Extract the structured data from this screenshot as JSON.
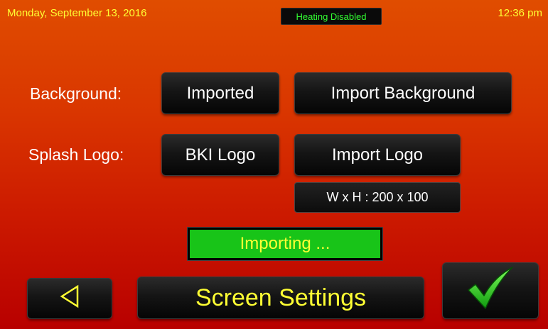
{
  "header": {
    "date": "Monday, September 13, 2016",
    "status": "Heating Disabled",
    "time": "12:36 pm"
  },
  "background": {
    "label": "Background:",
    "value_button": "Imported",
    "import_button": "Import Background"
  },
  "splash_logo": {
    "label": "Splash Logo:",
    "value_button": "BKI Logo",
    "import_button": "Import Logo",
    "dimensions": "W x H : 200 x 100"
  },
  "progress": {
    "label": "Importing ...",
    "fraction": 1.0
  },
  "footer": {
    "back_icon": "back-triangle-icon",
    "title": "Screen Settings",
    "confirm_icon": "checkmark-icon"
  },
  "colors": {
    "accent_yellow": "#ffff33",
    "status_green": "#33ff33",
    "progress_green": "#18c418",
    "checkmark_green": "#22cc22"
  }
}
